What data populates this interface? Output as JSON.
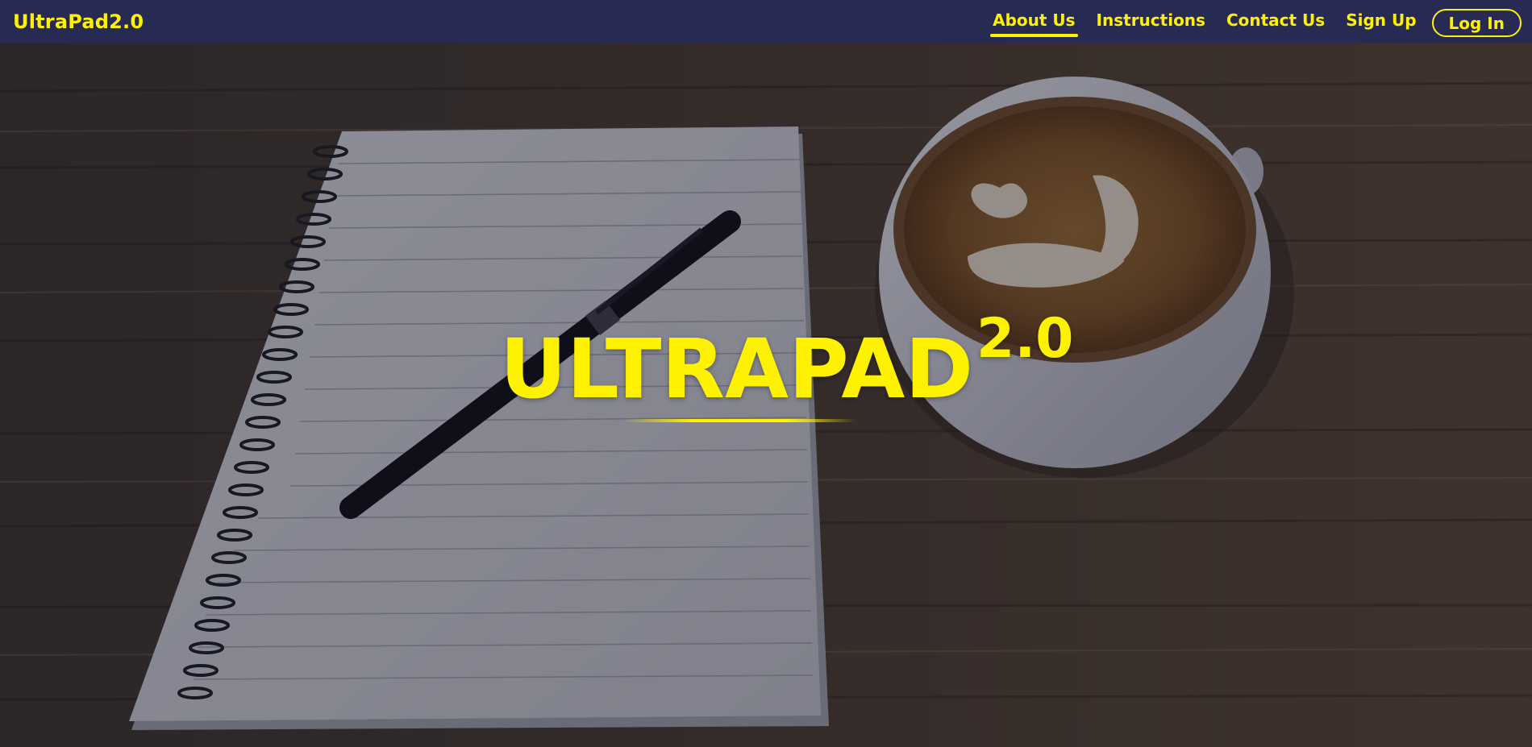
{
  "navbar": {
    "brand": "UltraPad2.0",
    "links": [
      {
        "label": "About Us",
        "active": true
      },
      {
        "label": "Instructions",
        "active": false
      },
      {
        "label": "Contact Us",
        "active": false
      },
      {
        "label": "Sign Up",
        "active": false
      }
    ],
    "login_label": "Log In"
  },
  "hero": {
    "title": "ULTRAPAD",
    "title_superscript": "2.0",
    "background_description_icon": "notebook-pen-coffee-photo"
  },
  "colors": {
    "accent": "#fff200",
    "navbar_bg": "#272a52",
    "wood": "#3b2a1e"
  }
}
